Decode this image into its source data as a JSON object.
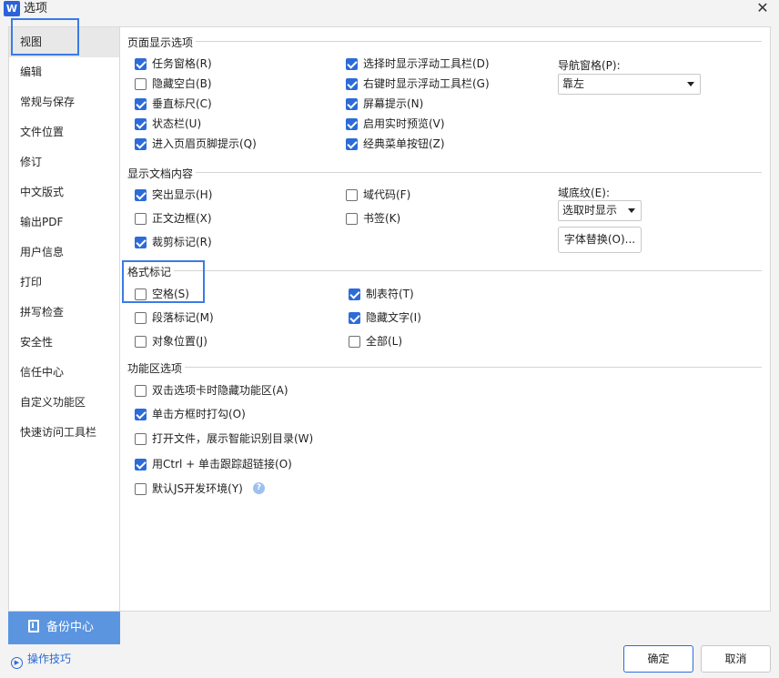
{
  "window": {
    "app_icon_letter": "W",
    "title": "选项",
    "close_glyph": "✕"
  },
  "sidebar": {
    "items": [
      {
        "label": "视图"
      },
      {
        "label": "编辑"
      },
      {
        "label": "常规与保存"
      },
      {
        "label": "文件位置"
      },
      {
        "label": "修订"
      },
      {
        "label": "中文版式"
      },
      {
        "label": "输出PDF"
      },
      {
        "label": "用户信息"
      },
      {
        "label": "打印"
      },
      {
        "label": "拼写检查"
      },
      {
        "label": "安全性"
      },
      {
        "label": "信任中心"
      },
      {
        "label": "自定义功能区"
      },
      {
        "label": "快速访问工具栏"
      }
    ],
    "active": "视图",
    "backup_label": "备份中心",
    "tips_label": "操作技巧"
  },
  "groups": {
    "page_display": {
      "title": "页面显示选项",
      "options": [
        {
          "label": "任务窗格(R)",
          "checked": true
        },
        {
          "label": "隐藏空白(B)",
          "checked": false
        },
        {
          "label": "垂直标尺(C)",
          "checked": true
        },
        {
          "label": "状态栏(U)",
          "checked": true
        },
        {
          "label": "进入页眉页脚提示(Q)",
          "checked": true
        },
        {
          "label": "选择时显示浮动工具栏(D)",
          "checked": true
        },
        {
          "label": "右键时显示浮动工具栏(G)",
          "checked": true
        },
        {
          "label": "屏幕提示(N)",
          "checked": true
        },
        {
          "label": "启用实时预览(V)",
          "checked": true
        },
        {
          "label": "经典菜单按钮(Z)",
          "checked": true
        }
      ],
      "nav_pane_label": "导航窗格(P):",
      "nav_pane_value": "靠左"
    },
    "doc_content": {
      "title": "显示文档内容",
      "options": [
        {
          "label": "突出显示(H)",
          "checked": true
        },
        {
          "label": "正文边框(X)",
          "checked": false
        },
        {
          "label": "裁剪标记(R)",
          "checked": true
        },
        {
          "label": "域代码(F)",
          "checked": false
        },
        {
          "label": "书签(K)",
          "checked": false
        }
      ],
      "field_shading_label": "域底纹(E):",
      "field_shading_value": "选取时显示",
      "font_replace_label": "字体替换(O)..."
    },
    "format_marks": {
      "title": "格式标记",
      "options": [
        {
          "label": "空格(S)",
          "checked": false
        },
        {
          "label": "段落标记(M)",
          "checked": false
        },
        {
          "label": "对象位置(J)",
          "checked": false
        },
        {
          "label": "制表符(T)",
          "checked": true
        },
        {
          "label": "隐藏文字(I)",
          "checked": true
        },
        {
          "label": "全部(L)",
          "checked": false
        }
      ]
    },
    "ribbon": {
      "title": "功能区选项",
      "options": [
        {
          "label": "双击选项卡时隐藏功能区(A)",
          "checked": false
        },
        {
          "label": "单击方框时打勾(O)",
          "checked": true
        },
        {
          "label": "打开文件，展示智能识别目录(W)",
          "checked": false
        },
        {
          "label": "用Ctrl + 单击跟踪超链接(O)",
          "checked": true
        },
        {
          "label": "默认JS开发环境(Y)",
          "checked": false
        }
      ],
      "help_glyph": "?"
    }
  },
  "footer": {
    "ok_label": "确定",
    "cancel_label": "取消"
  },
  "colors": {
    "accent": "#2c6bd8",
    "backup_bg": "#5b95e0",
    "highlight_outline": "#3a7be6"
  }
}
